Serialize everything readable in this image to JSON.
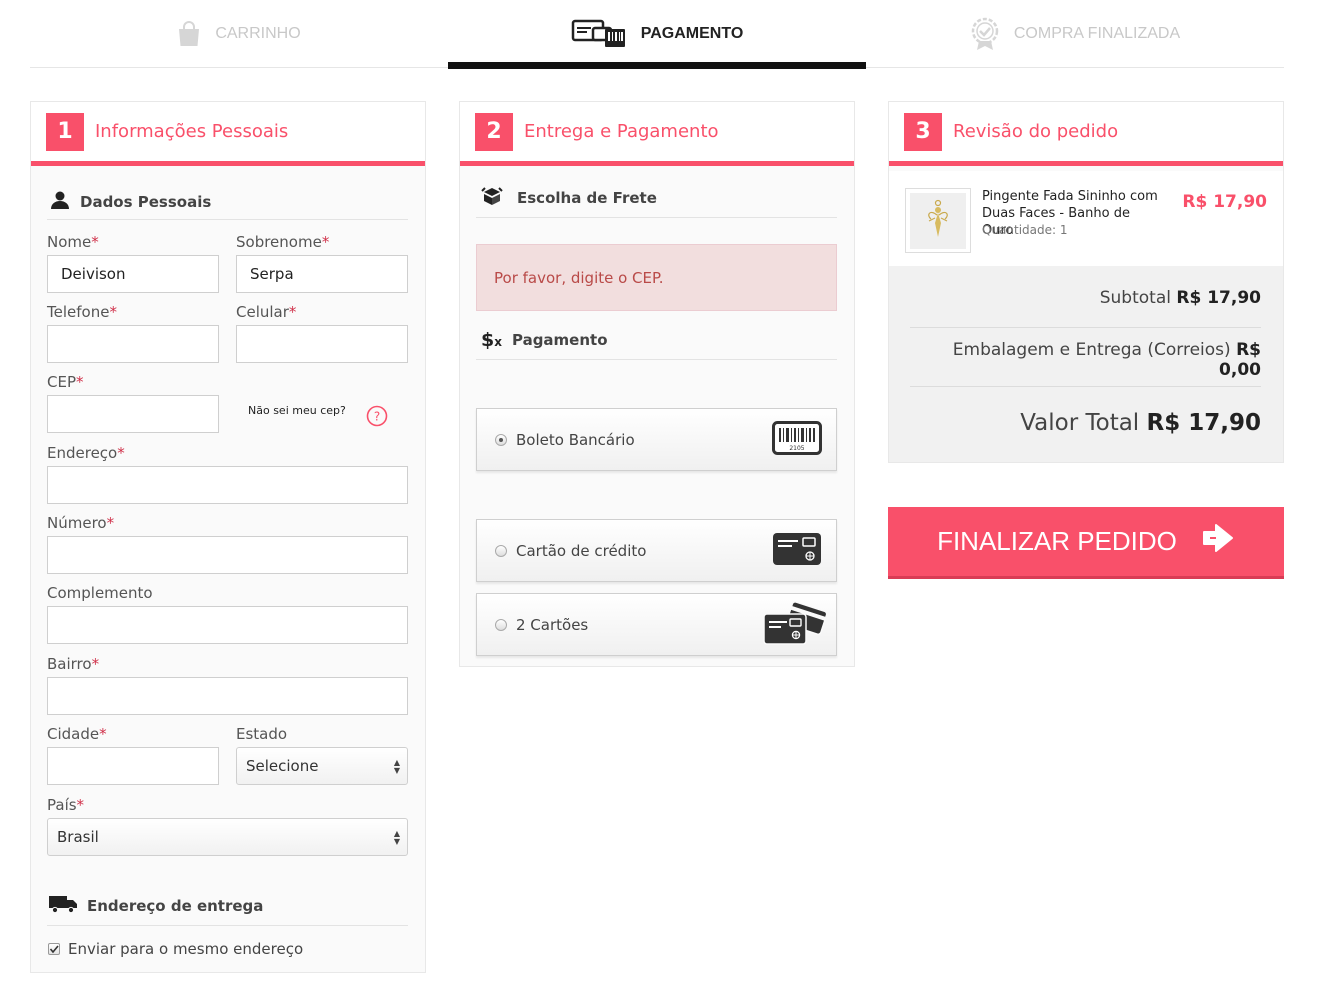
{
  "steps": [
    {
      "label": "CARRINHO",
      "state": "inactive",
      "icon": "shopping-bag-icon"
    },
    {
      "label": "PAGAMENTO",
      "state": "active",
      "icon": "payment-cards-icon"
    },
    {
      "label": "COMPRA FINALIZADA",
      "state": "inactive",
      "icon": "certificate-badge-icon"
    }
  ],
  "personal": {
    "number": "1",
    "title": "Informações Pessoais",
    "section": "Dados Pessoais",
    "required_mark": "*",
    "fields": {
      "nome": {
        "label": "Nome",
        "value": "Deivison"
      },
      "sobrenome": {
        "label": "Sobrenome",
        "value": "Serpa"
      },
      "telefone": {
        "label": "Telefone",
        "value": ""
      },
      "celular": {
        "label": "Celular",
        "value": ""
      },
      "cep": {
        "label": "CEP",
        "value": ""
      },
      "endereco": {
        "label": "Endereço",
        "value": ""
      },
      "numero": {
        "label": "Número",
        "value": ""
      },
      "complemento": {
        "label": "Complemento",
        "value": ""
      },
      "bairro": {
        "label": "Bairro",
        "value": ""
      },
      "cidade": {
        "label": "Cidade",
        "value": ""
      },
      "estado": {
        "label": "Estado",
        "value": "Selecione"
      },
      "pais": {
        "label": "País",
        "value": "Brasil"
      }
    },
    "cep_help": "Não sei meu cep?",
    "delivery_section": "Endereço de entrega",
    "same_address": {
      "label": "Enviar para o mesmo endereço",
      "checked": true
    }
  },
  "delivery": {
    "number": "2",
    "title": "Entrega e Pagamento",
    "shipping_section": "Escolha de Frete",
    "cep_alert": "Por favor, digite o CEP.",
    "payment_section": "Pagamento",
    "payment_options": [
      {
        "label": "Boleto Bancário",
        "selected": true,
        "icon": "barcode-boleto-icon"
      },
      {
        "label": "Cartão de crédito",
        "selected": false,
        "icon": "credit-card-icon"
      },
      {
        "label": "2 Cartões",
        "selected": false,
        "icon": "two-cards-icon"
      }
    ]
  },
  "review": {
    "number": "3",
    "title": "Revisão do pedido",
    "product": {
      "name": "Pingente Fada Sininho com Duas Faces - Banho de Ouro",
      "quantity_label": "Quantidade: 1",
      "price": "R$ 17,90"
    },
    "subtotal": {
      "label": "Subtotal",
      "value": "R$ 17,90"
    },
    "shipping": {
      "label": "Embalagem e Entrega (Correios)",
      "value": "R$ 0,00"
    },
    "total": {
      "label": "Valor Total",
      "value": "R$ 17,90"
    }
  },
  "finalize_button": "FINALIZAR PEDIDO",
  "colors": {
    "accent": "#f9506a",
    "alert_bg": "#f2dede",
    "alert_text": "#b94a48",
    "required": "#d0314a"
  }
}
